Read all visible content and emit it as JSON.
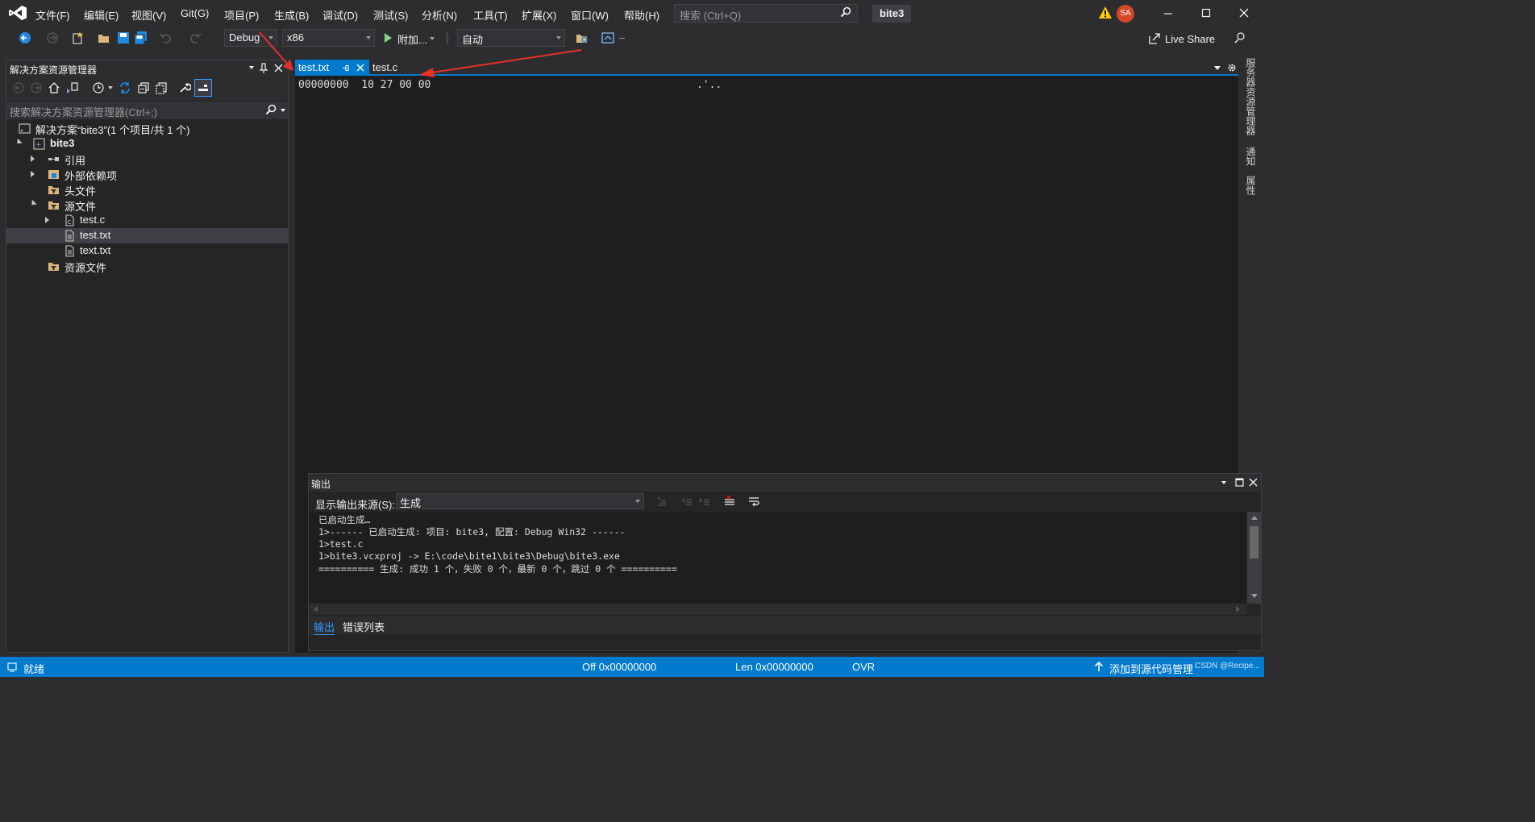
{
  "menu": [
    "文件(F)",
    "编辑(E)",
    "视图(V)",
    "Git(G)",
    "项目(P)",
    "生成(B)",
    "调试(D)",
    "测试(S)",
    "分析(N)",
    "工具(T)",
    "扩展(X)",
    "窗口(W)",
    "帮助(H)"
  ],
  "search": {
    "placeholder": "搜索 (Ctrl+Q)"
  },
  "solution_name": "bite3",
  "user_initials": "SA",
  "toolbar": {
    "config": "Debug",
    "platform": "x86",
    "run_label": "附加...",
    "auto_label": "自动",
    "liveshare": "Live Share"
  },
  "solution_explorer": {
    "title": "解决方案资源管理器",
    "search_placeholder": "搜索解决方案资源管理器(Ctrl+;)",
    "tree": [
      {
        "label": "解决方案“bite3”(1 个项目/共 1 个)",
        "bold": false
      },
      {
        "label": "bite3",
        "bold": true
      },
      {
        "label": "引用"
      },
      {
        "label": "外部依赖项"
      },
      {
        "label": "头文件"
      },
      {
        "label": "源文件"
      },
      {
        "label": "test.c"
      },
      {
        "label": "test.txt"
      },
      {
        "label": "text.txt"
      },
      {
        "label": "资源文件"
      }
    ]
  },
  "editor": {
    "tabs": [
      "test.txt",
      "test.c"
    ],
    "hex_line": "00000000  10 27 00 00",
    "hex_ascii": ".'.."
  },
  "right_rail": [
    "服务器资源管理器",
    "通知",
    "属性"
  ],
  "output": {
    "title": "输出",
    "source_label": "显示输出来源(S):",
    "source_value": "生成",
    "lines": [
      "已启动生成…",
      "1>------ 已启动生成: 项目: bite3, 配置: Debug Win32 ------",
      "1>test.c",
      "1>bite3.vcxproj -> E:\\code\\bite1\\bite3\\Debug\\bite3.exe",
      "========== 生成: 成功 1 个，失败 0 个，最新 0 个，跳过 0 个 =========="
    ],
    "tabs": [
      "输出",
      "错误列表"
    ]
  },
  "status": {
    "ready": "就绪",
    "offset": "Off 0x00000000",
    "length": "Len 0x00000000",
    "mode": "OVR",
    "source_control": "添加到源代码管理",
    "watermark": "CSDN @Recipe..."
  },
  "colors": {
    "accent": "#007acc",
    "annotation_arrow": "#e8302a"
  }
}
